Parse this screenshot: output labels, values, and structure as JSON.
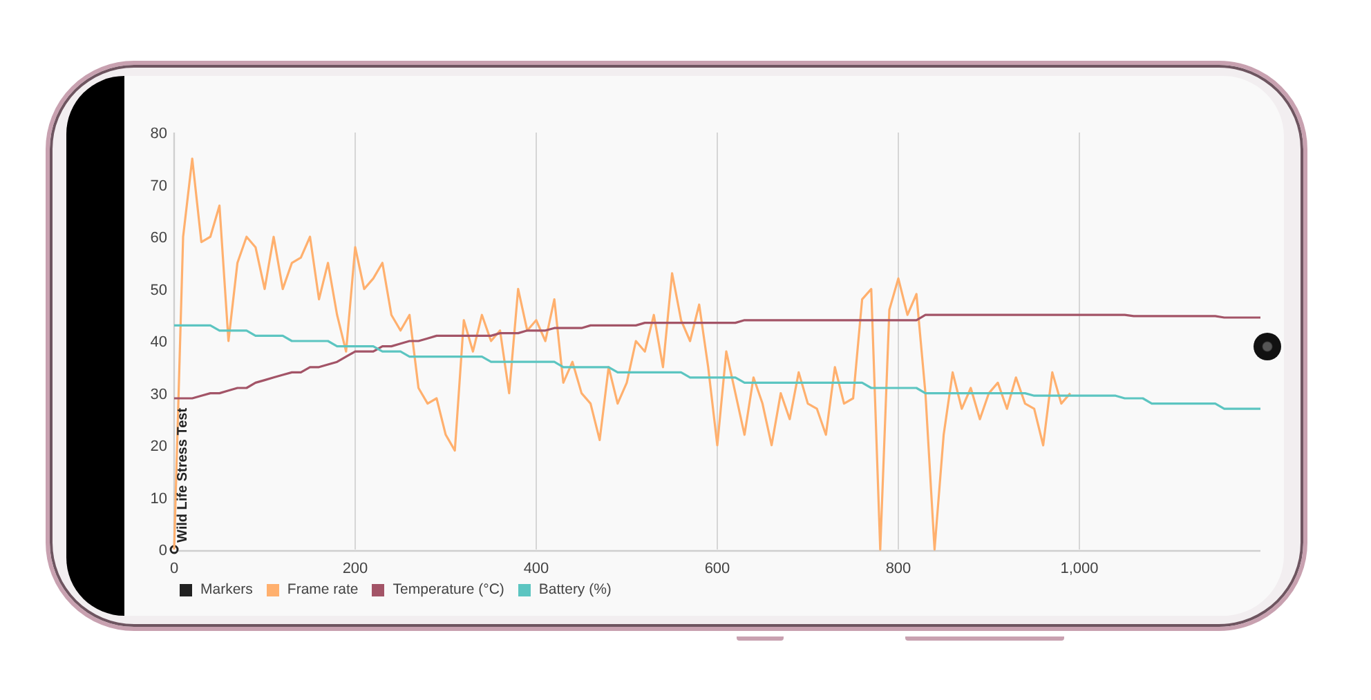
{
  "chart_data": {
    "type": "line",
    "grid": true,
    "xlim": [
      0,
      1200
    ],
    "ylim": [
      0,
      80
    ],
    "xticks": [
      0,
      200,
      400,
      600,
      800,
      {
        "value": 1000,
        "label": "1,000"
      }
    ],
    "yticks": [
      0,
      10,
      20,
      30,
      40,
      50,
      60,
      70,
      80
    ],
    "x": [
      0,
      10,
      20,
      30,
      40,
      50,
      60,
      70,
      80,
      90,
      100,
      110,
      120,
      130,
      140,
      150,
      160,
      170,
      180,
      190,
      200,
      210,
      220,
      230,
      240,
      250,
      260,
      270,
      280,
      290,
      300,
      310,
      320,
      330,
      340,
      350,
      360,
      370,
      380,
      390,
      400,
      410,
      420,
      430,
      440,
      450,
      460,
      470,
      480,
      490,
      500,
      510,
      520,
      530,
      540,
      550,
      560,
      570,
      580,
      590,
      600,
      610,
      620,
      630,
      640,
      650,
      660,
      670,
      680,
      690,
      700,
      710,
      720,
      730,
      740,
      750,
      760,
      770,
      780,
      790,
      800,
      810,
      820,
      830,
      840,
      850,
      860,
      870,
      880,
      890,
      900,
      910,
      920,
      930,
      940,
      950,
      960,
      970,
      980,
      990,
      1000,
      1010,
      1020,
      1030,
      1040,
      1050,
      1060,
      1070,
      1080,
      1090,
      1100,
      1110,
      1120,
      1130,
      1140,
      1150,
      1160,
      1170,
      1180,
      1190,
      1200
    ],
    "series": [
      {
        "name": "Markers",
        "marker": true,
        "color": "#222222",
        "values": [
          0,
          null,
          null,
          null,
          null,
          null,
          null,
          null,
          null,
          null,
          null,
          null,
          null,
          null,
          null,
          null,
          null,
          null,
          null,
          null,
          null,
          null,
          null,
          null,
          null,
          null,
          null,
          null,
          null,
          null,
          null,
          null,
          null,
          null,
          null,
          null,
          null,
          null,
          null,
          null,
          null,
          null,
          null,
          null,
          null,
          null,
          null,
          null,
          null,
          null,
          null,
          null,
          null,
          null,
          null,
          null,
          null,
          null,
          null,
          null,
          null,
          null,
          null,
          null,
          null,
          null,
          null,
          null,
          null,
          null,
          null,
          null,
          null,
          null,
          null,
          null,
          null,
          null,
          null,
          null,
          null,
          null,
          null,
          null,
          null,
          null,
          null,
          null,
          null,
          null,
          null,
          null,
          null,
          null,
          null,
          null,
          null,
          null,
          null,
          null,
          null,
          null,
          null,
          null,
          null,
          null,
          null,
          null,
          null,
          null,
          null,
          null,
          null,
          null,
          null,
          null,
          null,
          null,
          null,
          null,
          null
        ]
      },
      {
        "name": "Frame rate",
        "color": "#ffb06e",
        "values": [
          0,
          60,
          75,
          59,
          60,
          66,
          40,
          55,
          60,
          58,
          50,
          60,
          50,
          55,
          56,
          60,
          48,
          55,
          45,
          38,
          58,
          50,
          52,
          55,
          45,
          42,
          45,
          31,
          28,
          29,
          22,
          19,
          44,
          38,
          45,
          40,
          42,
          30,
          50,
          42,
          44,
          40,
          48,
          32,
          36,
          30,
          28,
          21,
          35,
          28,
          32,
          40,
          38,
          45,
          35,
          53,
          44,
          40,
          47,
          35,
          20,
          38,
          30,
          22,
          33,
          28,
          20,
          30,
          25,
          34,
          28,
          27,
          22,
          35,
          28,
          29,
          48,
          50,
          0,
          46,
          52,
          45,
          49,
          30,
          0,
          22,
          34,
          27,
          31,
          25,
          30,
          32,
          27,
          33,
          28,
          27,
          20,
          34,
          28,
          30,
          null,
          null,
          null,
          null,
          null,
          null,
          null,
          null,
          null,
          null,
          null,
          null,
          null,
          null,
          null,
          null,
          null,
          null,
          null,
          null,
          null
        ]
      },
      {
        "name": "Temperature (°C)",
        "color": "#a35467",
        "values": [
          29,
          29,
          29,
          29.5,
          30,
          30,
          30.5,
          31,
          31,
          32,
          32.5,
          33,
          33.5,
          34,
          34,
          35,
          35,
          35.5,
          36,
          37,
          38,
          38,
          38,
          39,
          39,
          39.5,
          40,
          40,
          40.5,
          41,
          41,
          41,
          41,
          41,
          41,
          41,
          41.5,
          41.5,
          41.5,
          42,
          42,
          42,
          42.5,
          42.5,
          42.5,
          42.5,
          43,
          43,
          43,
          43,
          43,
          43,
          43.5,
          43.5,
          43.5,
          43.5,
          43.5,
          43.5,
          43.5,
          43.5,
          43.5,
          43.5,
          43.5,
          44,
          44,
          44,
          44,
          44,
          44,
          44,
          44,
          44,
          44,
          44,
          44,
          44,
          44,
          44,
          44,
          44,
          44,
          44,
          44,
          45,
          45,
          45,
          45,
          45,
          45,
          45,
          45,
          45,
          45,
          45,
          45,
          45,
          45,
          45,
          45,
          45,
          45,
          45,
          45,
          45,
          45,
          45,
          44.8,
          44.8,
          44.8,
          44.8,
          44.8,
          44.8,
          44.8,
          44.8,
          44.8,
          44.8,
          44.5,
          44.5,
          44.5,
          44.5,
          44.5
        ]
      },
      {
        "name": "Battery (%)",
        "color": "#5cc5c1",
        "values": [
          43,
          43,
          43,
          43,
          43,
          42,
          42,
          42,
          42,
          41,
          41,
          41,
          41,
          40,
          40,
          40,
          40,
          40,
          39,
          39,
          39,
          39,
          39,
          38,
          38,
          38,
          37,
          37,
          37,
          37,
          37,
          37,
          37,
          37,
          37,
          36,
          36,
          36,
          36,
          36,
          36,
          36,
          36,
          35,
          35,
          35,
          35,
          35,
          35,
          34,
          34,
          34,
          34,
          34,
          34,
          34,
          34,
          33,
          33,
          33,
          33,
          33,
          33,
          32,
          32,
          32,
          32,
          32,
          32,
          32,
          32,
          32,
          32,
          32,
          32,
          32,
          32,
          31,
          31,
          31,
          31,
          31,
          31,
          30,
          30,
          30,
          30,
          30,
          30,
          30,
          30,
          30,
          30,
          30,
          30,
          29.5,
          29.5,
          29.5,
          29.5,
          29.5,
          29.5,
          29.5,
          29.5,
          29.5,
          29.5,
          29,
          29,
          29,
          28,
          28,
          28,
          28,
          28,
          28,
          28,
          28,
          27,
          27,
          27,
          27,
          27
        ]
      }
    ],
    "annotations": [
      {
        "x": 0,
        "y": 0,
        "text": "Wild Life Stress Test"
      }
    ]
  }
}
